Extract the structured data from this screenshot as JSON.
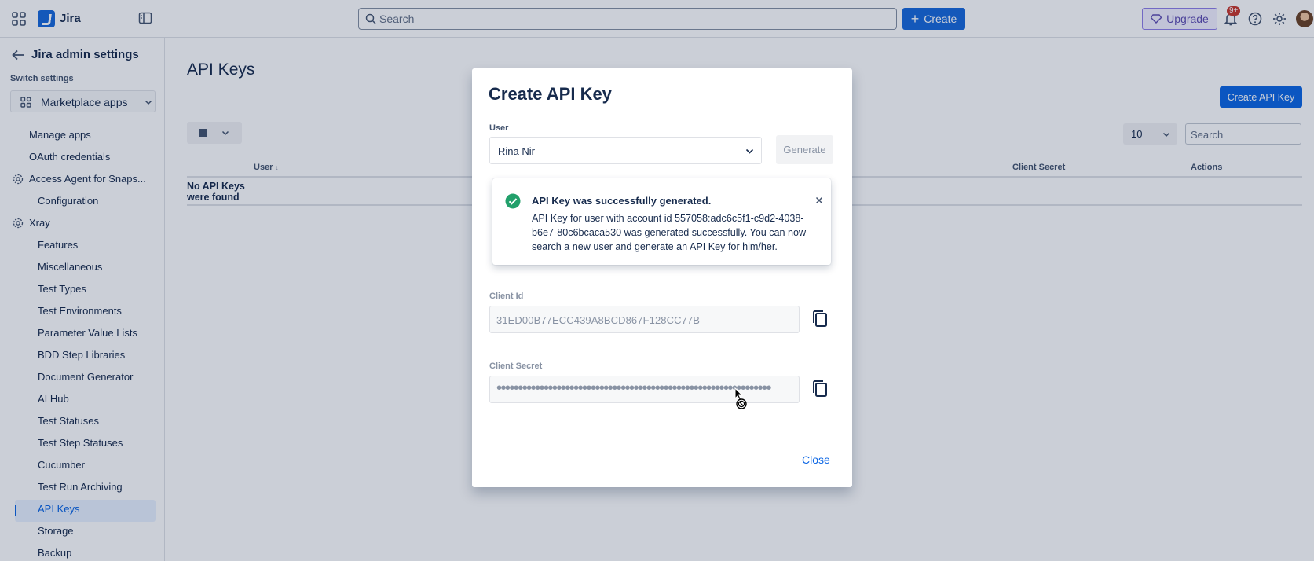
{
  "topbar": {
    "app_name": "Jira",
    "search_placeholder": "Search",
    "create_label": "Create",
    "upgrade_label": "Upgrade",
    "notifications_badge": "9+"
  },
  "sidebar": {
    "title": "Jira admin settings",
    "switch_label": "Switch settings",
    "switch_value": "Marketplace apps",
    "items": [
      {
        "label": "Manage apps"
      },
      {
        "label": "OAuth credentials"
      },
      {
        "label": "Access Agent for Snaps..."
      },
      {
        "label": "Configuration"
      },
      {
        "label": "Xray"
      },
      {
        "label": "Features"
      },
      {
        "label": "Miscellaneous"
      },
      {
        "label": "Test Types"
      },
      {
        "label": "Test Environments"
      },
      {
        "label": "Parameter Value Lists"
      },
      {
        "label": "BDD Step Libraries"
      },
      {
        "label": "Document Generator"
      },
      {
        "label": "AI Hub"
      },
      {
        "label": "Test Statuses"
      },
      {
        "label": "Test Step Statuses"
      },
      {
        "label": "Cucumber"
      },
      {
        "label": "Test Run Archiving"
      },
      {
        "label": "API Keys"
      },
      {
        "label": "Storage"
      },
      {
        "label": "Backup"
      }
    ]
  },
  "main": {
    "title": "API Keys",
    "create_button": "Create API Key",
    "page_size": "10",
    "search_placeholder": "Search",
    "columns": [
      "User",
      "Client Secret",
      "Actions"
    ],
    "empty_message": "No API Keys were found"
  },
  "modal": {
    "title": "Create API Key",
    "user_label": "User",
    "user_value": "Rina Nir",
    "generate_label": "Generate",
    "flag_title": "API Key was successfully generated.",
    "flag_body": "API Key for user with account id 557058:adc6c5f1-c9d2-4038-b6e7-80c6bcaca530 was generated successfully. You can now search a new user and generate an API Key for him/her.",
    "client_id_label": "Client Id",
    "client_id_value": "31ED00B77ECC439A8BCD867F128CC77B",
    "client_secret_label": "Client Secret",
    "client_secret_value": "••••••••••••••••••••••••••••••••••••••••••••••••••••••••••••••••",
    "close_label": "Close"
  },
  "colors": {
    "primary": "#0c66e4",
    "success": "#22a06b",
    "upgrade": "#5e4db2"
  }
}
